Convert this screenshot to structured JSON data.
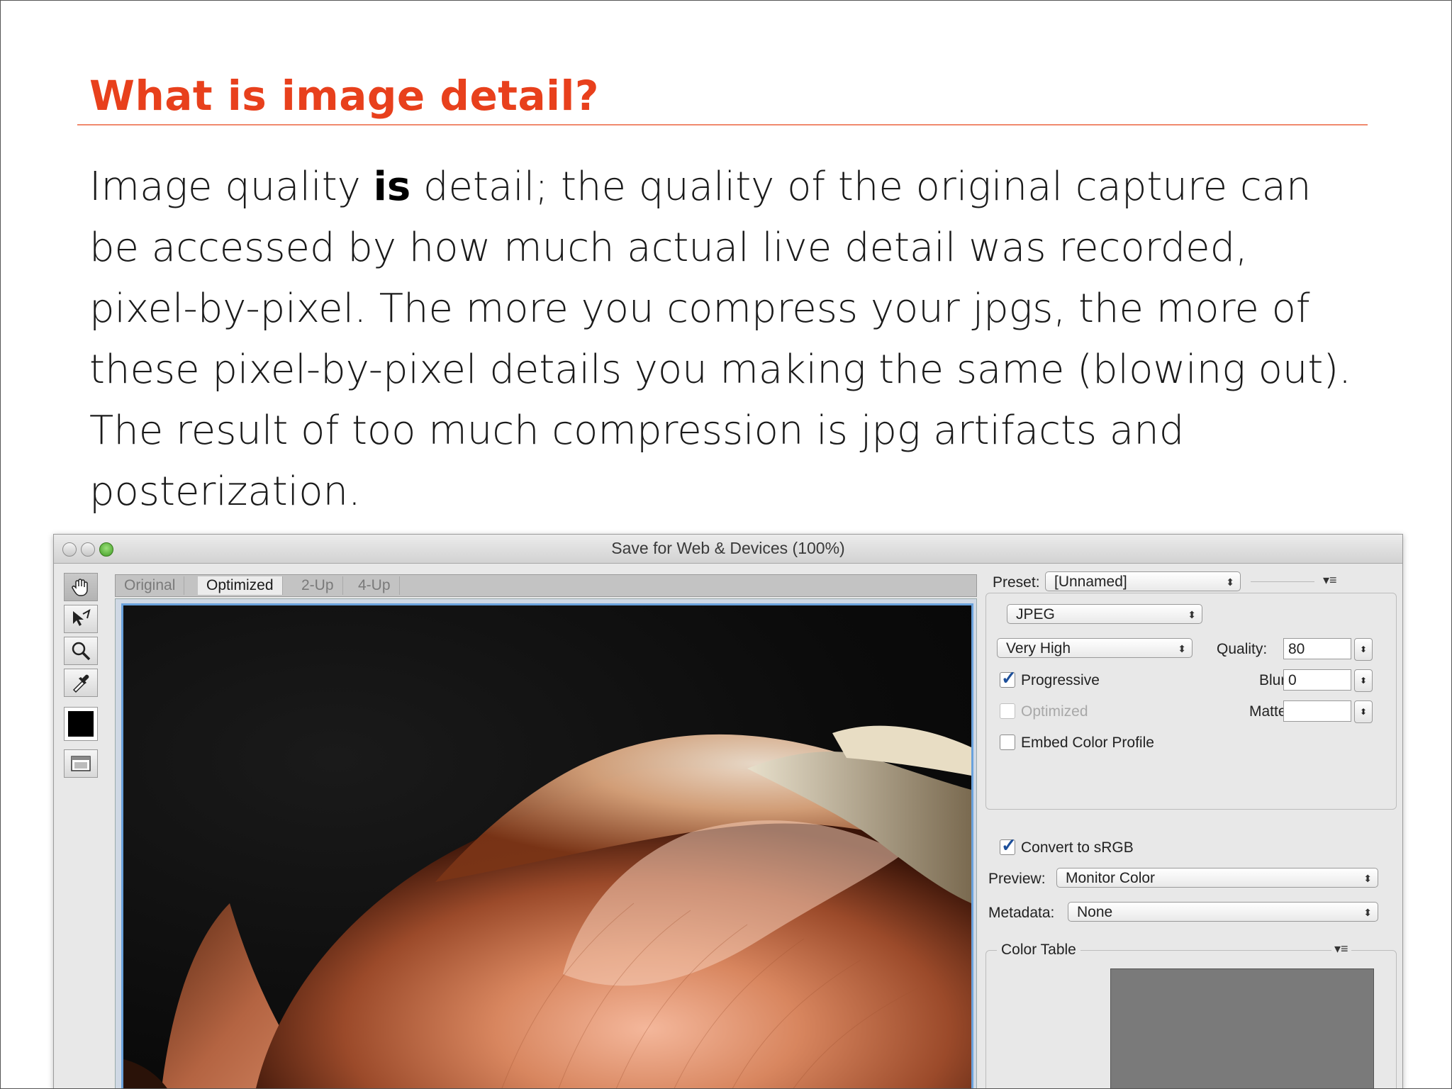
{
  "slide": {
    "title": "What is image detail?",
    "body_pre": "Image quality ",
    "body_bold": "is",
    "body_post": " detail; the quality of the original capture can be accessed by how much actual live detail was recorded, pixel-by-pixel. The more you compress your jpgs, the more of these pixel-by-pixel details you making the same (blowing out). The result of too much compression is jpg artifacts and posterization."
  },
  "window": {
    "title": "Save for Web & Devices (100%)",
    "tabs": [
      "Original",
      "Optimized",
      "2-Up",
      "4-Up"
    ],
    "active_tab": "Optimized",
    "tools": [
      "hand-tool-icon",
      "slice-select-tool-icon",
      "zoom-tool-icon",
      "eyedropper-tool-icon"
    ],
    "eyedropper_color": "#000000"
  },
  "panel": {
    "preset_label": "Preset:",
    "preset_value": "[Unnamed]",
    "format_value": "JPEG",
    "quality_preset_value": "Very High",
    "quality_label": "Quality:",
    "quality_value": "80",
    "blur_label": "Blur:",
    "blur_value": "0",
    "matte_label": "Matte:",
    "matte_value": "",
    "progressive_label": "Progressive",
    "progressive_checked": true,
    "optimized_label": "Optimized",
    "optimized_checked": false,
    "embed_label": "Embed Color Profile",
    "embed_checked": false,
    "srgb_label": "Convert to sRGB",
    "srgb_checked": true,
    "preview_label": "Preview:",
    "preview_value": "Monitor Color",
    "metadata_label": "Metadata:",
    "metadata_value": "None",
    "color_table_label": "Color Table"
  },
  "colors": {
    "title": "#e8401c",
    "rule": "#f08a6e",
    "canvas_border": "#6aa2dc",
    "check": "#1d4f9a",
    "color_table_fill": "#7a7a7a"
  }
}
